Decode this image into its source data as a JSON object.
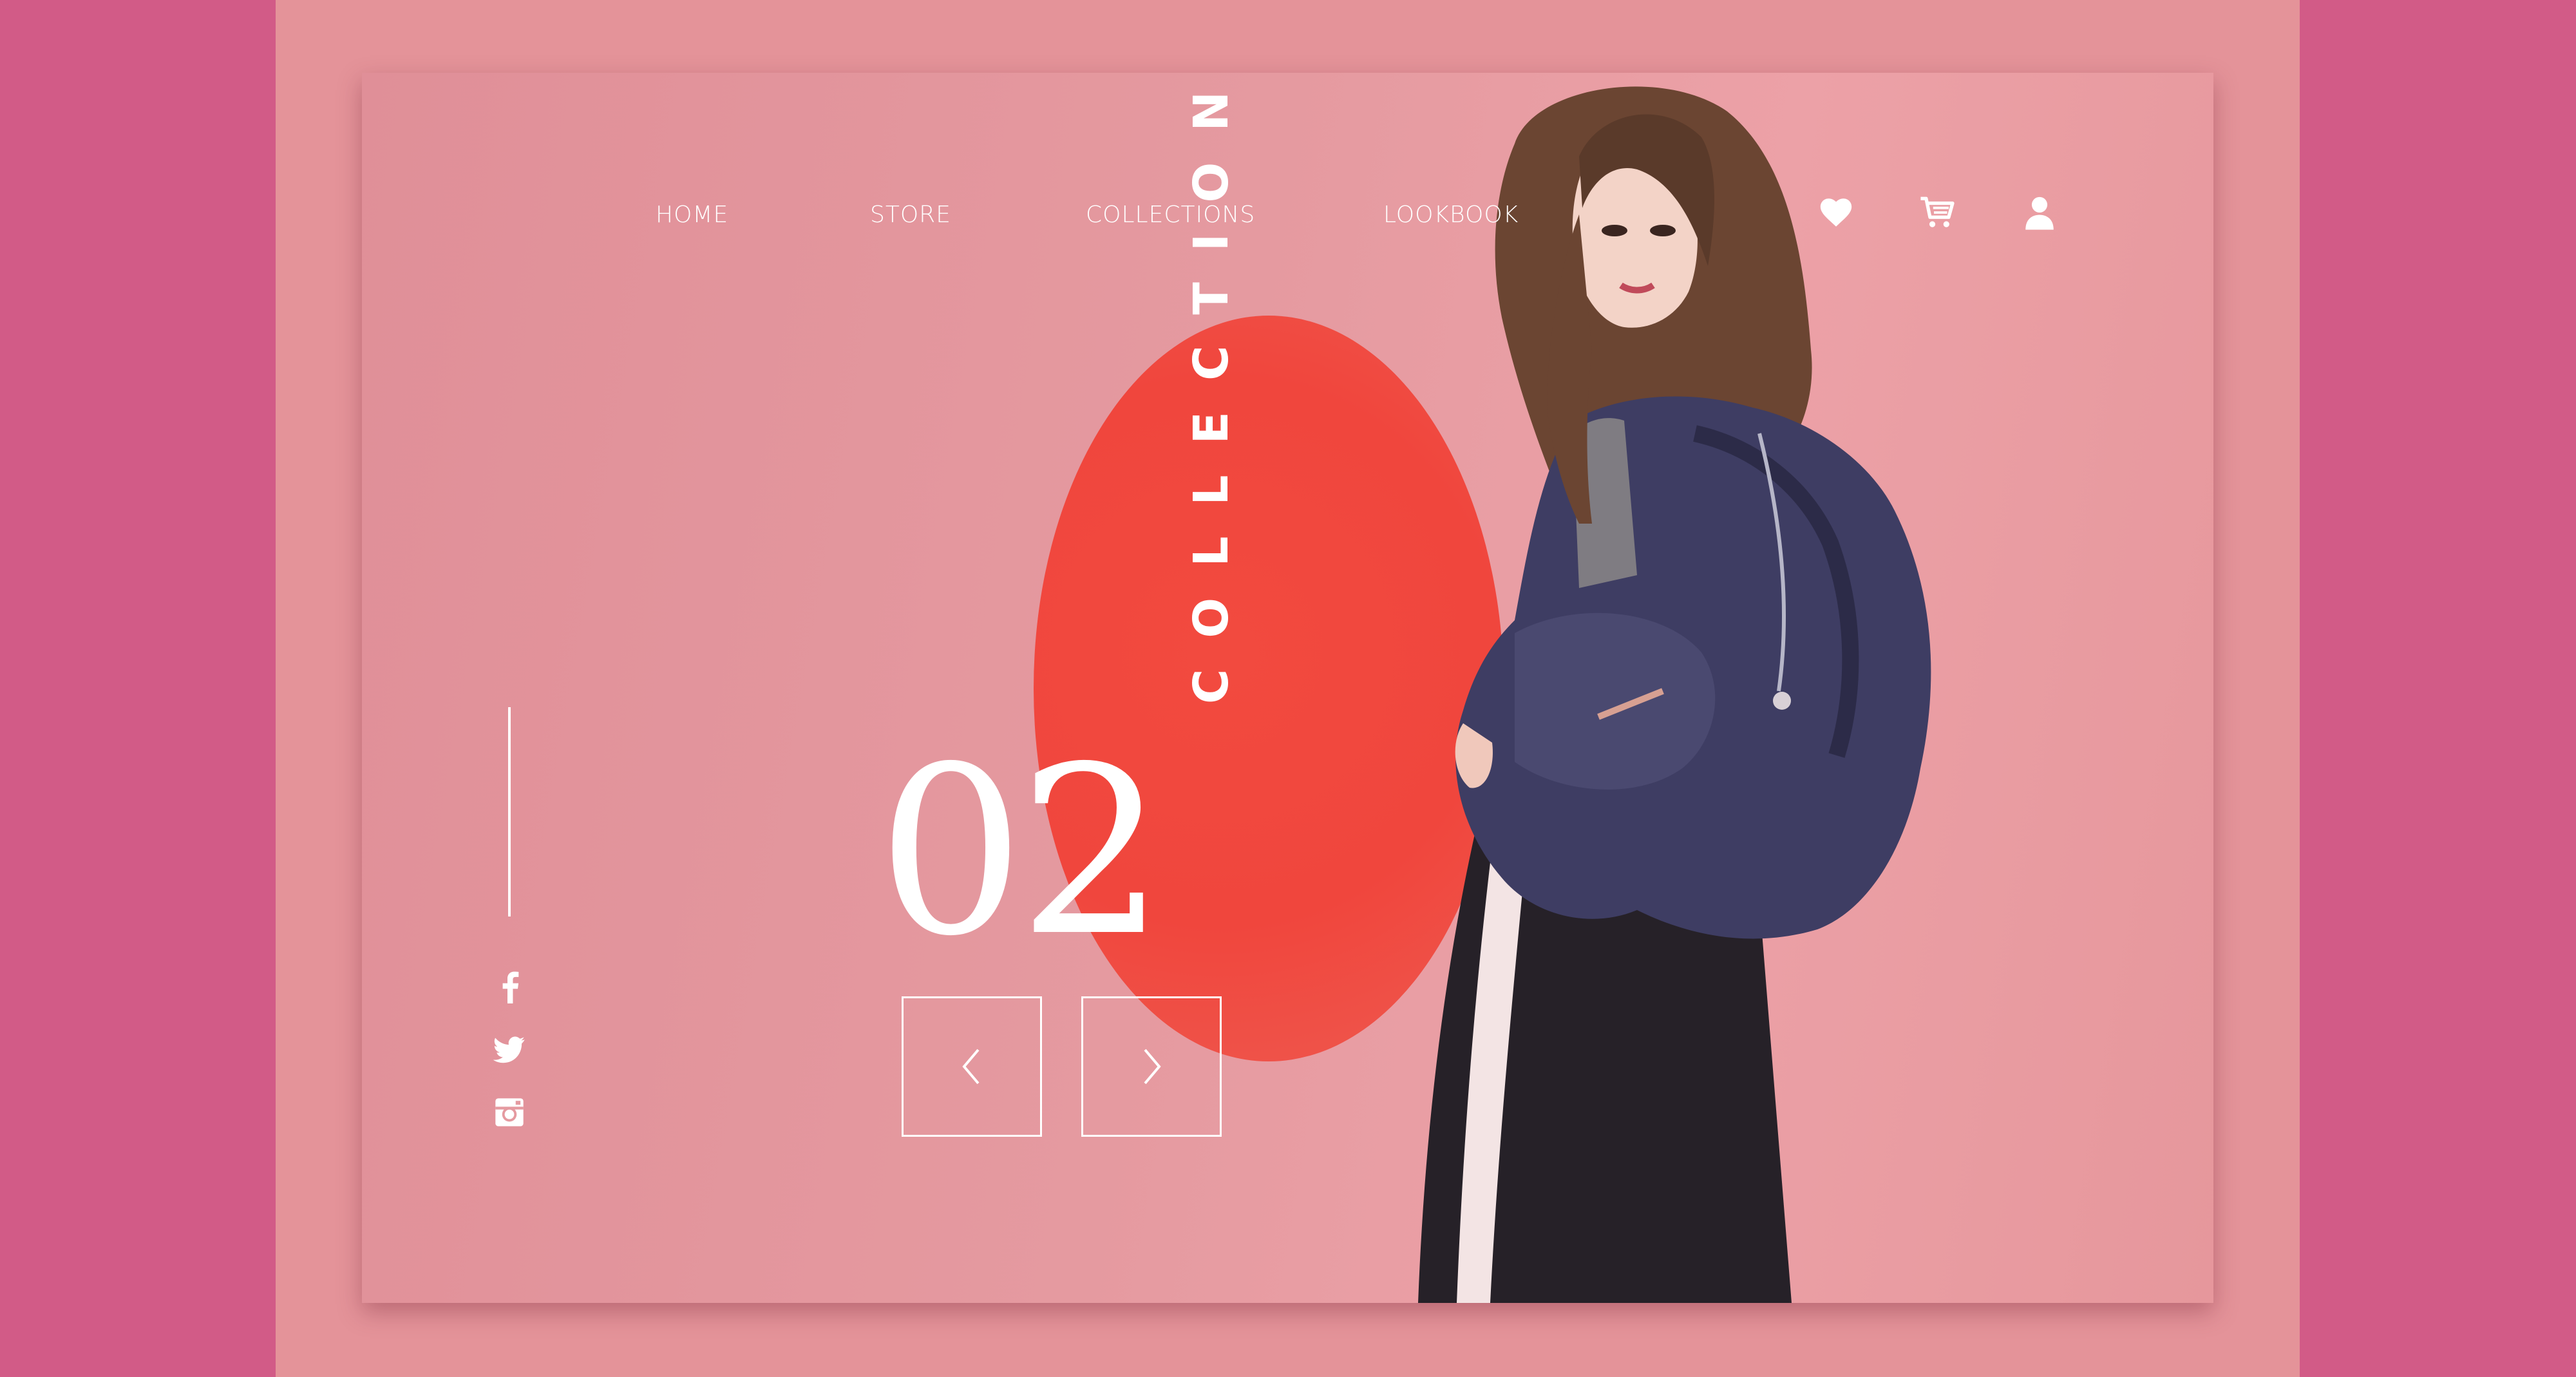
{
  "nav": {
    "links": [
      "HOME",
      "STORE",
      "COLLECTIONS",
      "LOOKBOOK"
    ],
    "icons": [
      "heart-icon",
      "cart-icon",
      "user-icon"
    ]
  },
  "social": {
    "icons": [
      "facebook-icon",
      "twitter-icon",
      "instagram-icon"
    ]
  },
  "hero": {
    "number": "02",
    "title": "COLLECTION"
  },
  "slider": {
    "prev_icon": "chevron-left-icon",
    "next_icon": "chevron-right-icon"
  },
  "colors": {
    "page_background": "#d25b87",
    "frame_background": "#e49399",
    "accent_circle": "#f0463d",
    "text": "#ffffff",
    "jacket": "#3e3d63"
  }
}
